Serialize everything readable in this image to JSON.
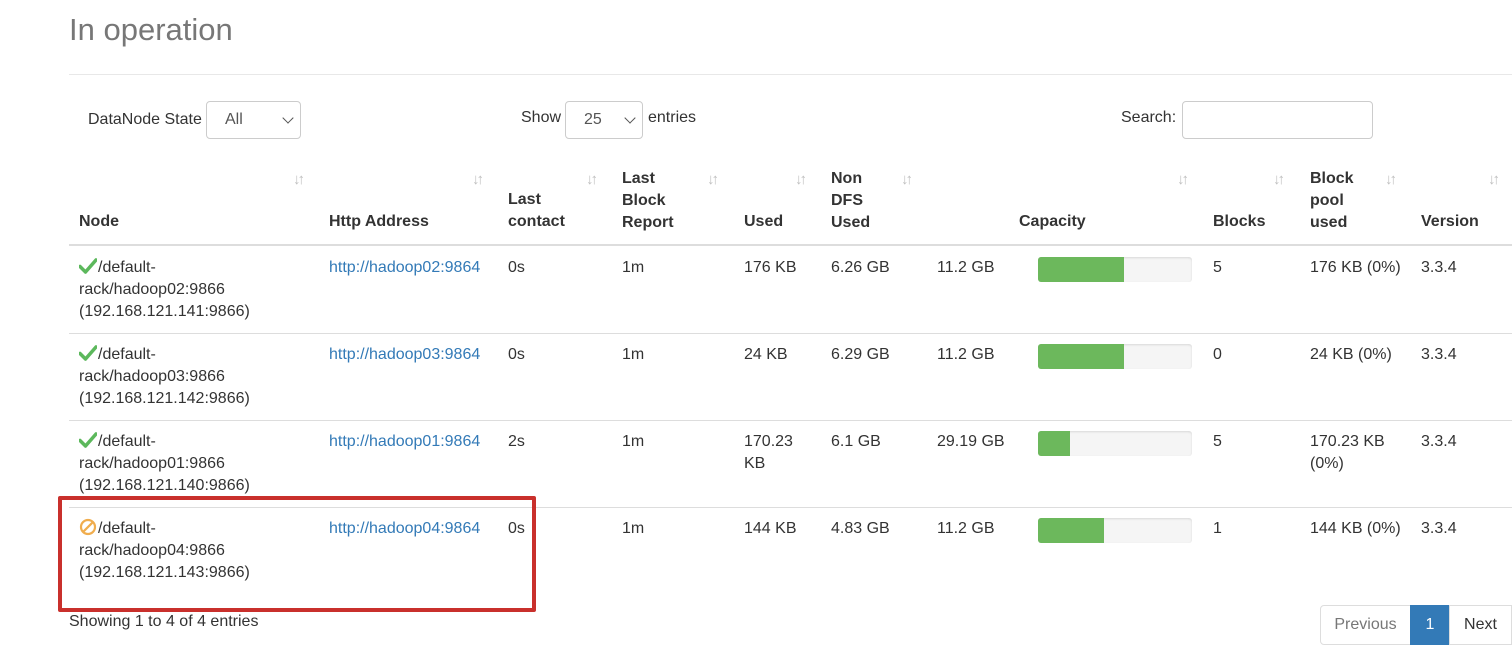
{
  "title": "In operation",
  "filters": {
    "state_label": "DataNode State",
    "state_value": "All",
    "show_label": "Show",
    "show_value": "25",
    "entries_label": "entries",
    "search_label": "Search:",
    "search_value": ""
  },
  "columns": {
    "node": "Node",
    "http": "Http Address",
    "last_contact_1": "Last",
    "last_contact_2": "contact",
    "lbr_1": "Last",
    "lbr_2": "Block",
    "lbr_3": "Report",
    "used": "Used",
    "nondfs_1": "Non",
    "nondfs_2": "DFS",
    "nondfs_3": "Used",
    "capacity": "Capacity",
    "blocks": "Blocks",
    "bpu_1": "Block",
    "bpu_2": "pool",
    "bpu_3": "used",
    "version": "Version"
  },
  "rows": [
    {
      "status_icon": "check-icon",
      "node_1": "/default-",
      "node_2": "rack/hadoop02:9866",
      "node_3": "(192.168.121.141:9866)",
      "http": "http://hadoop02:9864",
      "last_contact": "0s",
      "last_block_report": "1m",
      "used_1": "176 KB",
      "used_2": "",
      "non_dfs_used": "6.26 GB",
      "capacity": "11.2 GB",
      "capacity_used_pct": 56,
      "blocks": "5",
      "bpu_1": "176 KB (0%)",
      "bpu_2": "",
      "version": "3.3.4"
    },
    {
      "status_icon": "check-icon",
      "node_1": "/default-",
      "node_2": "rack/hadoop03:9866",
      "node_3": "(192.168.121.142:9866)",
      "http": "http://hadoop03:9864",
      "last_contact": "0s",
      "last_block_report": "1m",
      "used_1": "24 KB",
      "used_2": "",
      "non_dfs_used": "6.29 GB",
      "capacity": "11.2 GB",
      "capacity_used_pct": 56,
      "blocks": "0",
      "bpu_1": "24 KB (0%)",
      "bpu_2": "",
      "version": "3.3.4"
    },
    {
      "status_icon": "check-icon",
      "node_1": "/default-",
      "node_2": "rack/hadoop01:9866",
      "node_3": "(192.168.121.140:9866)",
      "http": "http://hadoop01:9864",
      "last_contact": "2s",
      "last_block_report": "1m",
      "used_1": "170.23",
      "used_2": "KB",
      "non_dfs_used": "6.1 GB",
      "capacity": "29.19 GB",
      "capacity_used_pct": 21,
      "blocks": "5",
      "bpu_1": "170.23 KB",
      "bpu_2": "(0%)",
      "version": "3.3.4"
    },
    {
      "status_icon": "ban-icon",
      "node_1": "/default-",
      "node_2": "rack/hadoop04:9866",
      "node_3": "(192.168.121.143:9866)",
      "http": "http://hadoop04:9864",
      "last_contact": "0s",
      "last_block_report": "1m",
      "used_1": "144 KB",
      "used_2": "",
      "non_dfs_used": "4.83 GB",
      "capacity": "11.2 GB",
      "capacity_used_pct": 43,
      "blocks": "1",
      "bpu_1": "144 KB (0%)",
      "bpu_2": "",
      "version": "3.3.4"
    }
  ],
  "footer": {
    "info": "Showing 1 to 4 of 4 entries",
    "prev": "Previous",
    "current": "1",
    "next": "Next"
  },
  "colors": {
    "link": "#337ab7",
    "bar_fill": "#6cb85c",
    "check": "#5cb85c",
    "ban": "#f0ad4e",
    "highlight": "#c9302c"
  }
}
